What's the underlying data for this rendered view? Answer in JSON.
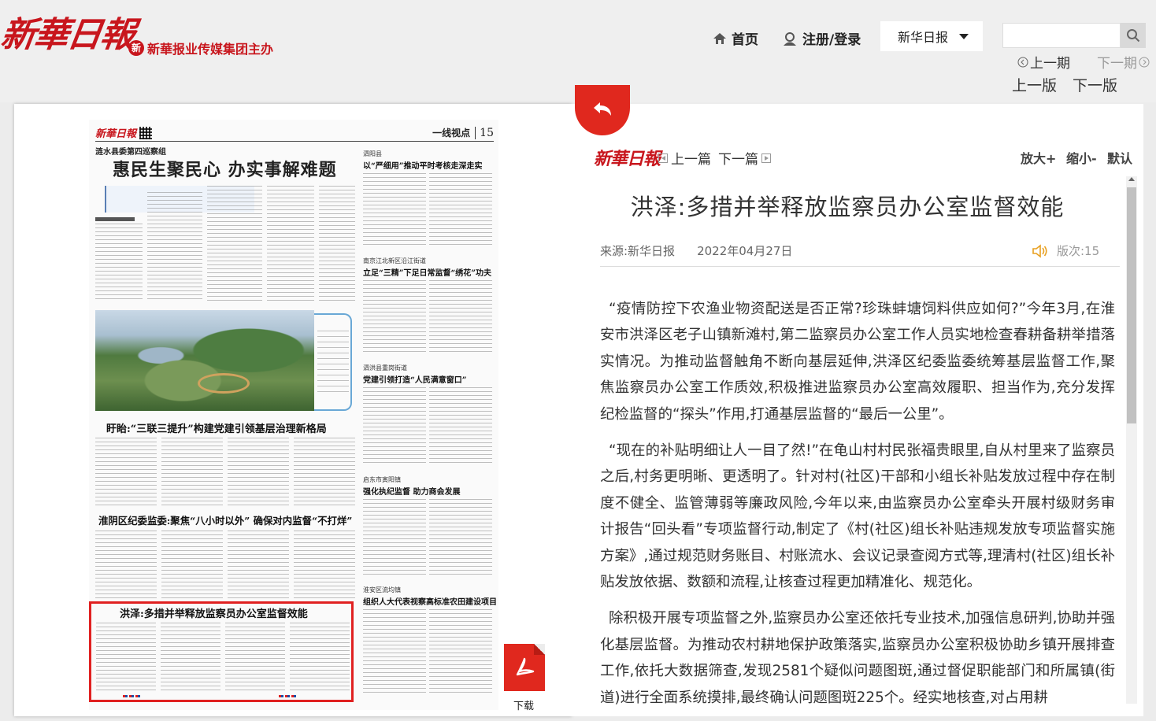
{
  "header": {
    "logo": "新華日報",
    "sub_logo": "新華报业传媒集团主办",
    "nav_home": "首页",
    "nav_login": "注册/登录",
    "paper_select": "新华日报",
    "search_placeholder": "",
    "prev_issue": "上一期",
    "next_issue": "下一期",
    "prev_edition": "上一版",
    "next_edition": "下一版"
  },
  "newspaper": {
    "mini_logo": "新華日報",
    "section": "一线视点",
    "page_num": "15",
    "kicker": "涟水县委第四巡察组",
    "main_title": "惠民生聚民心 办实事解难题",
    "story1_title": "盱眙:“三联三提升”构建党建引领基层治理新格局",
    "story2_title": "淮阴区纪委监委:聚焦“八小时以外” 确保对内监督“不打烊”",
    "story3_title": "洪泽:多措并举释放监察员办公室监督效能",
    "side1_kicker": "泗阳县",
    "side1_title": "以“严细用”推动平时考核走深走实",
    "side2_kicker": "南京江北新区沿江街道",
    "side2_title": "立足“三精”下足日常监督“绣花”功夫",
    "side3_kicker": "泗洪县重岗街道",
    "side3_title": "党建引领打造“人民满意窗口”",
    "side4_kicker": "启东市寅阳镇",
    "side4_title": "强化执纪监督 助力商会发展",
    "side5_kicker": "淮安区流均镇",
    "side5_title": "组织人大代表视察高标准农田建设项目"
  },
  "download_label": "下载",
  "article": {
    "logo": "新華日報",
    "prev": "上一篇",
    "next": "下一篇",
    "zoom_in": "放大+",
    "zoom_out": "缩小-",
    "zoom_default": "默认",
    "title": "洪泽:多措并举释放监察员办公室监督效能",
    "source": "来源:新华日报",
    "date": "2022年04月27日",
    "edition": "版次:15",
    "paragraphs": [
      "“疫情防控下农渔业物资配送是否正常?珍珠蚌塘饲料供应如何?”今年3月,在淮安市洪泽区老子山镇新滩村,第二监察员办公室工作人员实地检查春耕备耕举措落实情况。为推动监督触角不断向基层延伸,洪泽区纪委监委统筹基层监督工作,聚焦监察员办公室工作质效,积极推进监察员办公室高效履职、担当作为,充分发挥纪检监督的“探头”作用,打通基层监督的“最后一公里”。",
      "“现在的补贴明细让人一目了然!”在龟山村村民张福贵眼里,自从村里来了监察员之后,村务更明晰、更透明了。针对村(社区)干部和小组长补贴发放过程中存在制度不健全、监管薄弱等廉政风险,今年以来,由监察员办公室牵头开展村级财务审计报告“回头看”专项监督行动,制定了《村(社区)组长补贴违规发放专项监督实施方案》,通过规范财务账目、村账流水、会议记录查阅方式等,理清村(社区)组长补贴发放依据、数额和流程,让核查过程更加精准化、规范化。",
      "除积极开展专项监督之外,监察员办公室还依托专业技术,加强信息研判,协助并强化基层监督。为推动农村耕地保护政策落实,监察员办公室积极协助乡镇开展排查工作,依托大数据筛查,发现2581个疑似问题图斑,通过督促职能部门和所属镇(街道)进行全面系统摸排,最终确认问题图斑225个。经实地核查,对占用耕"
    ]
  },
  "colors": {
    "brand_red": "#c8161d",
    "highlight_red": "#e02020"
  }
}
